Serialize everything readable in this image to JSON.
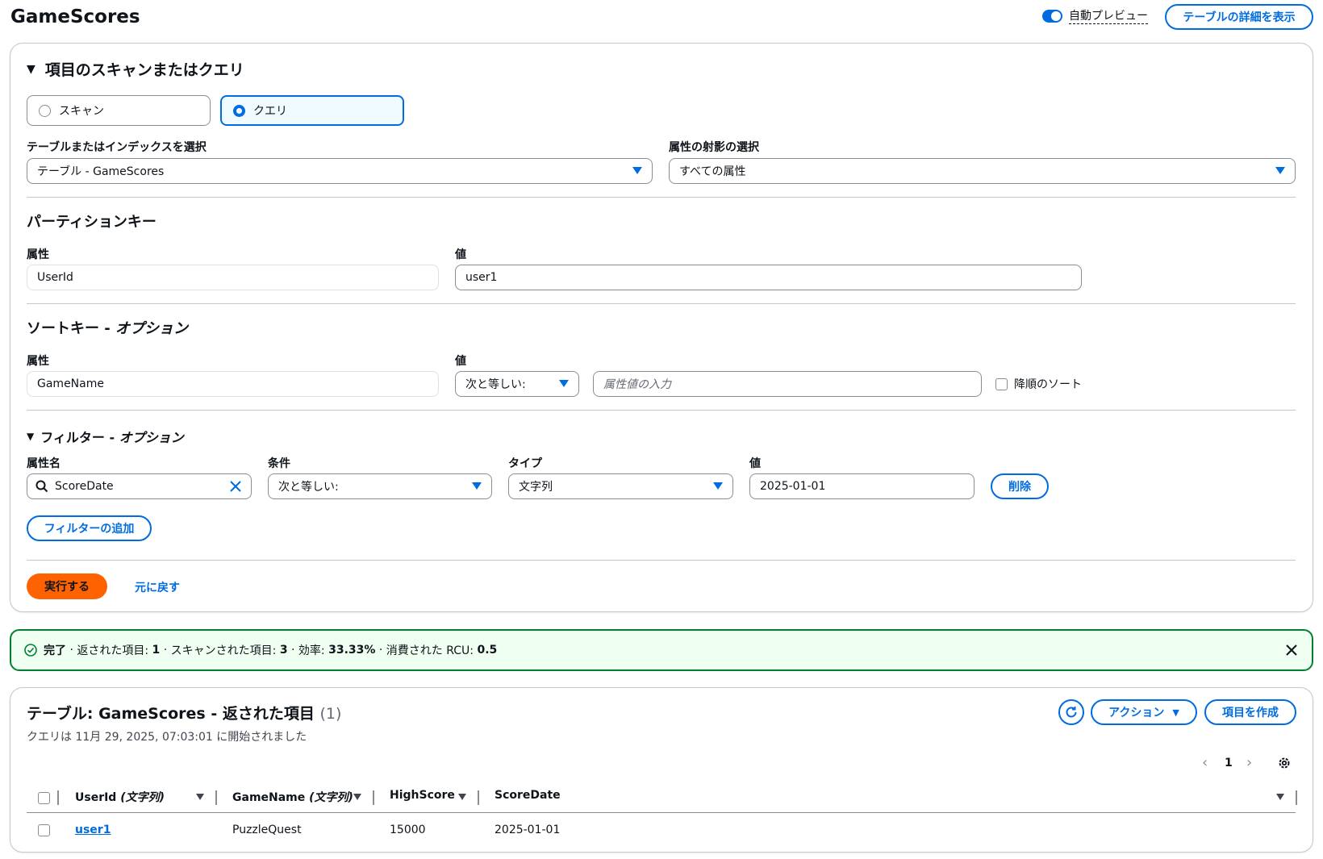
{
  "header": {
    "title": "GameScores",
    "auto_preview": "自動プレビュー",
    "view_details": "テーブルの詳細を表示"
  },
  "query_panel": {
    "title": "項目のスキャンまたはクエリ",
    "modes": [
      {
        "label": "スキャン",
        "selected": false
      },
      {
        "label": "クエリ",
        "selected": true
      }
    ],
    "table_select": {
      "label": "テーブルまたはインデックスを選択",
      "value": "テーブル - GameScores"
    },
    "projection": {
      "label": "属性の射影の選択",
      "value": "すべての属性"
    },
    "partition": {
      "title": "パーティションキー",
      "attr_label": "属性",
      "attr_value": "UserId",
      "value_label": "値",
      "value": "user1"
    },
    "sort": {
      "title_main": "ソートキー - ",
      "title_opt": "オプション",
      "attr_label": "属性",
      "attr_value": "GameName",
      "value_label": "値",
      "condition": "次と等しい:",
      "value_placeholder": "属性値の入力",
      "descending": "降順のソート"
    },
    "filter": {
      "title_main": "フィルター - ",
      "title_opt": "オプション",
      "attr_label": "属性名",
      "attr_value": "ScoreDate",
      "cond_label": "条件",
      "cond_value": "次と等しい:",
      "type_label": "タイプ",
      "type_value": "文字列",
      "value_label": "値",
      "value": "2025-01-01",
      "delete": "削除",
      "add": "フィルターの追加"
    },
    "run": "実行する",
    "reset": "元に戻す"
  },
  "flash": {
    "status": "完了",
    "returned_label": "返された項目:",
    "returned": "1",
    "scanned_label": "スキャンされた項目:",
    "scanned": "3",
    "efficiency_label": "効率:",
    "efficiency": "33.33%",
    "rcu_label": "消費された RCU:",
    "rcu": "0.5"
  },
  "results": {
    "title": "テーブル: GameScores - 返された項目",
    "count": "(1)",
    "subtitle": "クエリは 11月 29, 2025, 07:03:01 に開始されました",
    "actions": "アクション",
    "create_item": "項目を作成",
    "page": "1",
    "columns": [
      {
        "name": "UserId",
        "type": "(文字列)"
      },
      {
        "name": "GameName",
        "type": "(文字列)"
      },
      {
        "name": "HighScore",
        "type": ""
      },
      {
        "name": "ScoreDate",
        "type": ""
      }
    ],
    "rows": [
      {
        "UserId": "user1",
        "GameName": "PuzzleQuest",
        "HighScore": "15000",
        "ScoreDate": "2025-01-01"
      }
    ]
  },
  "colors": {
    "accent": "#006ce0",
    "run": "#ff6200",
    "success": "#00802f"
  }
}
